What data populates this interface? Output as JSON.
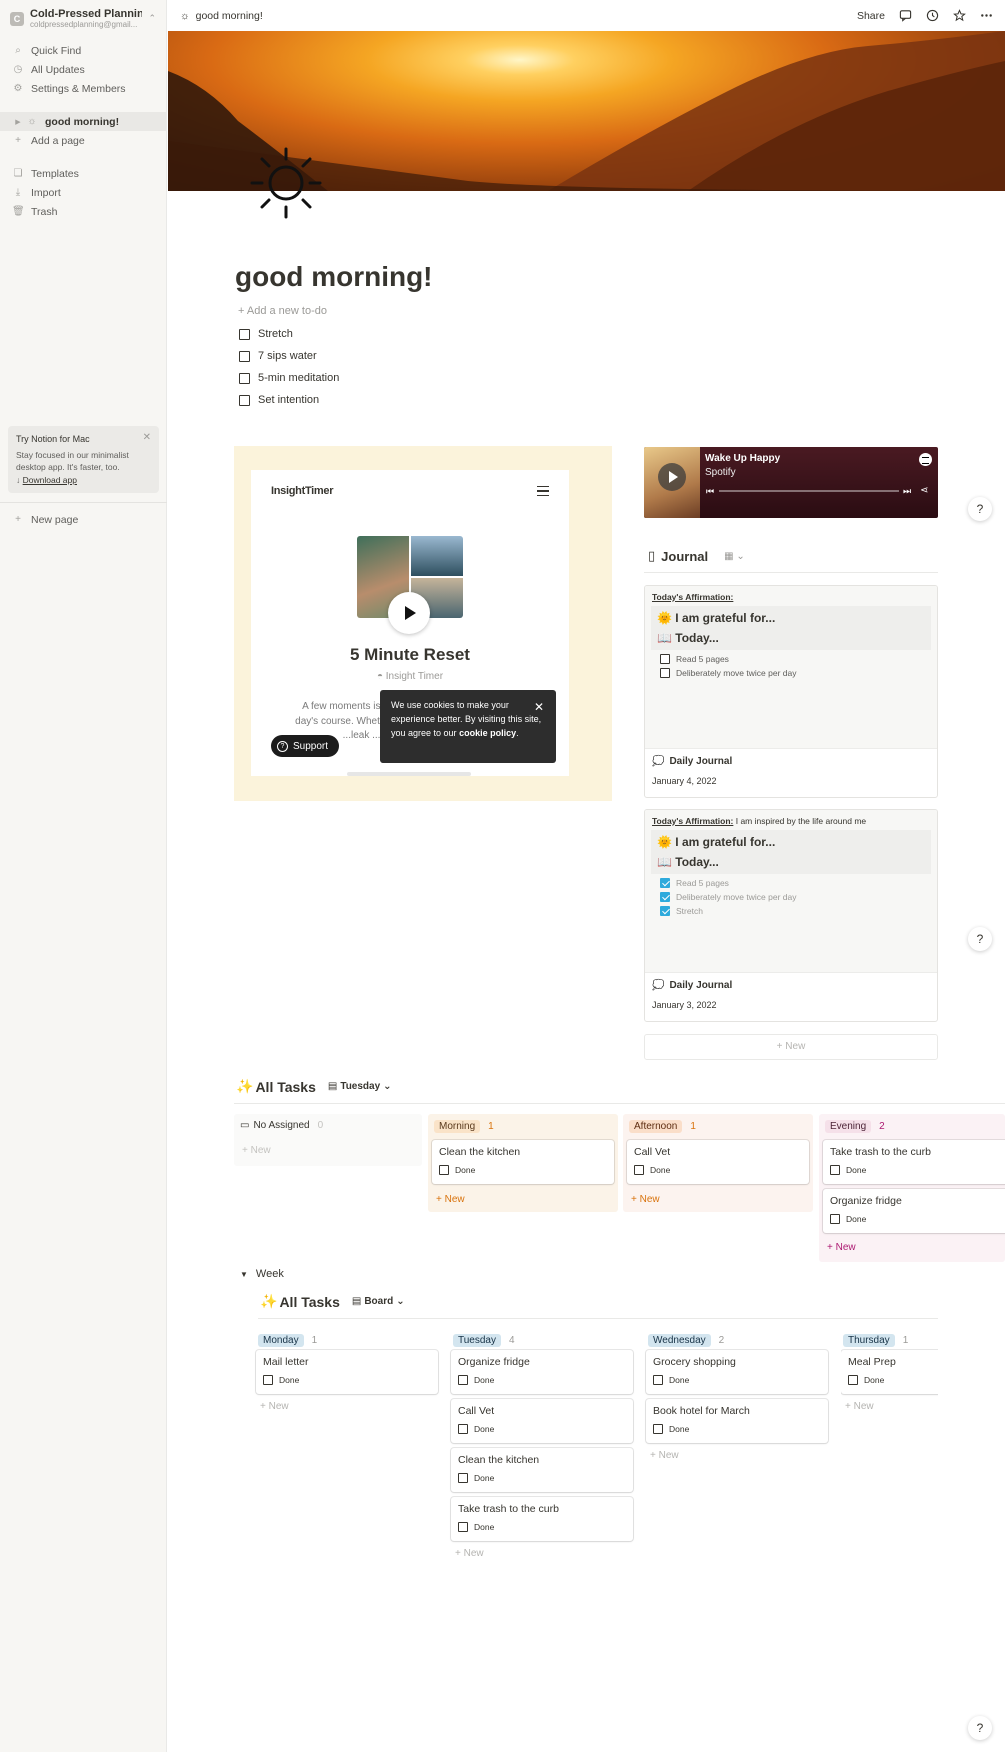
{
  "sidebar": {
    "workspace_name": "Cold-Pressed Planning...",
    "workspace_email": "coldpressedplanning@gmail...",
    "workspace_initial": "C",
    "items": [
      {
        "label": "Quick Find",
        "icon": "search-icon"
      },
      {
        "label": "All Updates",
        "icon": "clock-icon"
      },
      {
        "label": "Settings & Members",
        "icon": "gear-icon"
      }
    ],
    "pages": [
      {
        "label": "good morning!",
        "icon": "sun-icon",
        "active": true
      },
      {
        "label": "Add a page",
        "icon": "plus-icon"
      }
    ],
    "tools": [
      {
        "label": "Templates",
        "icon": "templates-icon"
      },
      {
        "label": "Import",
        "icon": "import-icon"
      },
      {
        "label": "Trash",
        "icon": "trash-icon"
      }
    ],
    "promo": {
      "title": "Try Notion for Mac",
      "body": "Stay focused in our minimalist desktop app. It's faster, too.",
      "link": "Download app"
    },
    "new_page": "New page"
  },
  "topbar": {
    "breadcrumb": "good morning!",
    "share": "Share"
  },
  "page": {
    "title": "good morning!",
    "add_todo": "Add a new to-do",
    "todos": [
      "Stretch",
      "7 sips water",
      "5-min meditation",
      "Set intention"
    ]
  },
  "insight": {
    "logo": "InsightTimer",
    "title": "5 Minute Reset",
    "author": "Insight Timer",
    "desc": "A few moments is al day's course. Whethe ...leak ...es",
    "support": "Support",
    "cookie_text": "We use cookies to make your experience better. By visiting this site, you agree to our",
    "cookie_link": "cookie policy"
  },
  "spotify": {
    "song": "Wake Up Happy",
    "artist": "Spotify"
  },
  "journal": {
    "title": "Journal",
    "entries": [
      {
        "affirmation_label": "Today's Affirmation:",
        "affirmation_text": "",
        "grateful": "I am grateful for...",
        "today": "Today...",
        "checks": [
          {
            "label": "Read 5 pages",
            "done": false
          },
          {
            "label": "Deliberately move twice per day",
            "done": false
          }
        ],
        "name": "Daily Journal",
        "date": "January 4, 2022"
      },
      {
        "affirmation_label": "Today's Affirmation:",
        "affirmation_text": "I am inspired by the life around me",
        "grateful": "I am grateful for...",
        "today": "Today...",
        "checks": [
          {
            "label": "Read 5 pages",
            "done": true
          },
          {
            "label": "Deliberately move twice per day",
            "done": true
          },
          {
            "label": "Stretch",
            "done": true
          }
        ],
        "name": "Daily Journal",
        "date": "January 3, 2022"
      }
    ],
    "new_label": "New"
  },
  "tasks_day": {
    "title": "All Tasks",
    "view": "Tuesday",
    "done_label": "Done",
    "new_label": "New",
    "columns": [
      {
        "name": "No Assigned",
        "count": "0",
        "cards": []
      },
      {
        "name": "Morning",
        "count": "1",
        "cards": [
          "Clean the kitchen"
        ]
      },
      {
        "name": "Afternoon",
        "count": "1",
        "cards": [
          "Call Vet"
        ]
      },
      {
        "name": "Evening",
        "count": "2",
        "cards": [
          "Take trash to the curb",
          "Organize fridge"
        ]
      }
    ]
  },
  "week": {
    "toggle": "Week",
    "title": "All Tasks",
    "view": "Board",
    "done_label": "Done",
    "new_label": "New",
    "columns": [
      {
        "name": "Monday",
        "count": "1",
        "cards": [
          "Mail letter"
        ]
      },
      {
        "name": "Tuesday",
        "count": "4",
        "cards": [
          "Organize fridge",
          "Call Vet",
          "Clean the kitchen",
          "Take trash to the curb"
        ]
      },
      {
        "name": "Wednesday",
        "count": "2",
        "cards": [
          "Grocery shopping",
          "Book hotel for March"
        ]
      },
      {
        "name": "Thursday",
        "count": "1",
        "cards": [
          "Meal Prep"
        ]
      }
    ]
  },
  "help_label": "?"
}
